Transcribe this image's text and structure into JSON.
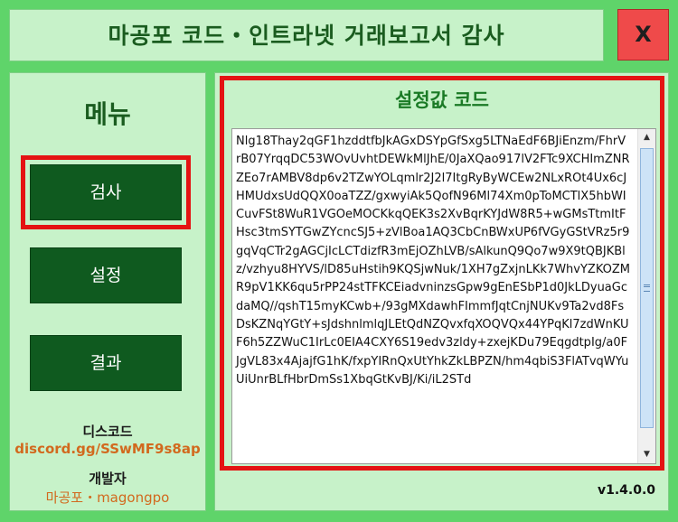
{
  "window": {
    "title": "마공포 코드・인트라넷 거래보고서 감사",
    "close_label": "X"
  },
  "sidebar": {
    "menu_title": "메뉴",
    "buttons": [
      {
        "label": "검사",
        "active": true
      },
      {
        "label": "설정",
        "active": false
      },
      {
        "label": "결과",
        "active": false
      }
    ],
    "discord_label": "디스코드",
    "discord_link": "discord.gg/SSwMF9s8ap",
    "developer_label": "개발자",
    "developer_name": "마공포・magongpo"
  },
  "main": {
    "panel_title": "설정값 코드",
    "code_text": "Nlg18Thay2qGF1hzddtfbJkAGxDSYpGfSxg5LTNaEdF6BJiEnzm/FhrVrB07YrqqDC53WOvUvhtDEWkMlJhE/0JaXQao917lV2FTc9XCHImZNRZEo7rAMBV8dp6v2TZwYOLqmlr2J2l7ItgRyByWCEw2NLxROt4Ux6cJHMUdxsUdQQX0oaTZZ/gxwyiAk5QofN96Ml74Xm0pToMCTlX5hbWICuvFSt8WuR1VGOeMOCKkqQEK3s2XvBqrKYJdW8R5+wGMsTtmItFHsc3tmSYTGwZYcncSJ5+zVlBoa1AQ3CbCnBWxUP6fVGyGStVRz5r9gqVqCTr2gAGCjIcLCTdizfR3mEjOZhLVB/sAlkunQ9Qo7w9X9tQBJKBlz/vzhyu8HYVS/lD85uHstih9KQSjwNuk/1XH7gZxjnLKk7WhvYZKOZMR9pV1KK6qu5rPP24stTFKCEiadvninzsGpw9gEnESbP1d0JkLDyuaGcdaMQ//qshT15myKCwb+/93gMXdawhFImmfJqtCnjNUKv9Ta2vd8FsDsKZNqYGtY+sJdshnlmlqJLEtQdNZQvxfqXOQVQx44YPqKl7zdWnKUF6h5ZZWuC1IrLc0EIA4CXY6S19edv3zldy+zxejKDu79EqgdtpIg/a0FJgVL83x4AjajfG1hK/fxpYIRnQxUtYhkZkLBPZN/hm4qbiS3FlATvqWYuUiUnrBLfHbrDmSs1XbqGtKvBJ/Ki/iL2STd",
    "version": "v1.4.0.0"
  },
  "colors": {
    "window_bg": "#5fd46a",
    "panel_bg": "#c7f2c9",
    "button_bg": "#0f5a1f",
    "highlight": "#e41313",
    "close_bg": "#ef4a4a",
    "link_color": "#d2691e",
    "title_text": "#1a5c1f"
  }
}
